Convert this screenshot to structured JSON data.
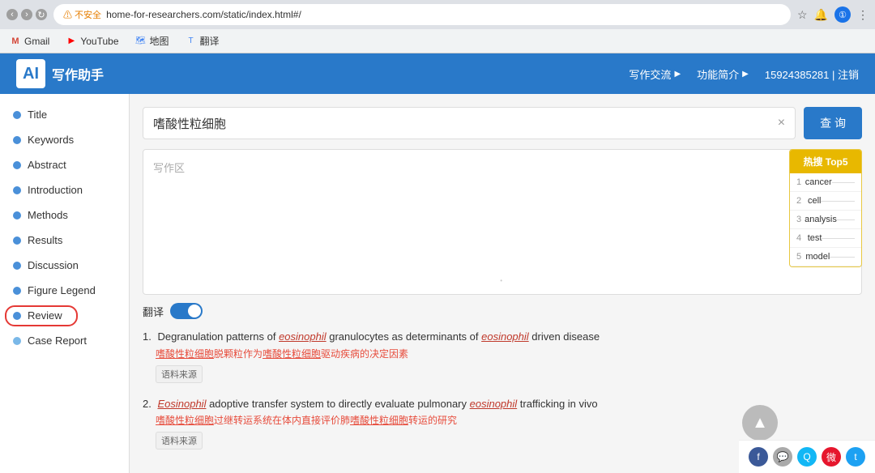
{
  "browser": {
    "address": "home-for-researchers.com/static/index.html#/",
    "warning_text": "不安全",
    "bookmarks": [
      {
        "name": "Gmail",
        "icon": "G",
        "type": "gmail"
      },
      {
        "name": "YouTube",
        "icon": "▶",
        "type": "youtube"
      },
      {
        "name": "地图",
        "icon": "📍",
        "type": "maps"
      },
      {
        "name": "翻译",
        "icon": "T",
        "type": "translate"
      }
    ]
  },
  "header": {
    "logo_letter": "AI",
    "logo_text": "写作助手",
    "nav": [
      {
        "label": "写作交流",
        "has_arrow": true
      },
      {
        "label": "功能简介",
        "has_arrow": true
      },
      {
        "label": "15924385281 | 注销"
      }
    ]
  },
  "sidebar": {
    "items": [
      {
        "label": "Title",
        "dot_color": "blue"
      },
      {
        "label": "Keywords",
        "dot_color": "blue"
      },
      {
        "label": "Abstract",
        "dot_color": "blue"
      },
      {
        "label": "Introduction",
        "dot_color": "blue"
      },
      {
        "label": "Methods",
        "dot_color": "blue"
      },
      {
        "label": "Results",
        "dot_color": "blue"
      },
      {
        "label": "Discussion",
        "dot_color": "blue"
      },
      {
        "label": "Figure Legend",
        "dot_color": "blue"
      },
      {
        "label": "Review",
        "dot_color": "blue",
        "highlighted": true
      },
      {
        "label": "Case Report",
        "dot_color": "light-blue"
      }
    ]
  },
  "search": {
    "value": "嗜酸性粒细胞",
    "placeholder": "写作区",
    "button_label": "查 询",
    "clear_icon": "×"
  },
  "writing_area": {
    "placeholder": "写作区"
  },
  "translation": {
    "label": "翻译",
    "enabled": true
  },
  "hot_panel": {
    "title": "热搜 Top5",
    "items": [
      {
        "rank": 1,
        "text": "cancer"
      },
      {
        "rank": 2,
        "text": "cell"
      },
      {
        "rank": 3,
        "text": "analysis"
      },
      {
        "rank": 4,
        "text": "test"
      },
      {
        "rank": 5,
        "text": "model"
      }
    ]
  },
  "results": [
    {
      "number": "1.",
      "text_parts": [
        {
          "type": "normal",
          "text": "Degranulation patterns of "
        },
        {
          "type": "italic-red",
          "text": "eosinophil"
        },
        {
          "type": "normal",
          "text": " granulocytes as determinants of "
        },
        {
          "type": "italic-red",
          "text": "eosinophil"
        },
        {
          "type": "normal",
          "text": " driven disease"
        }
      ],
      "translation_parts": [
        {
          "type": "underline-red",
          "text": "嗜酸性粒细胞"
        },
        {
          "type": "normal-red",
          "text": "脱颗粒作为"
        },
        {
          "type": "underline-red",
          "text": "嗜酸性粒细胞"
        },
        {
          "type": "normal-red",
          "text": "驱动疾病的决定因素"
        }
      ],
      "source_label": "语料来源"
    },
    {
      "number": "2.",
      "text_parts": [
        {
          "type": "italic-red",
          "text": "Eosinophil"
        },
        {
          "type": "normal",
          "text": " adoptive transfer system to directly evaluate pulmonary "
        },
        {
          "type": "italic-red",
          "text": "eosinophil"
        },
        {
          "type": "normal",
          "text": " trafficking in vivo"
        }
      ],
      "translation_parts": [
        {
          "type": "underline-red",
          "text": "嗜酸性粒细胞"
        },
        {
          "type": "normal-red",
          "text": "过继转运系统在体内直接评价肺"
        },
        {
          "type": "underline-red",
          "text": "嗜酸性粒细胞"
        },
        {
          "type": "normal-red",
          "text": "转运的研究"
        }
      ],
      "source_label": "语料来源"
    }
  ],
  "social_icons": [
    {
      "name": "facebook",
      "symbol": "f",
      "color": "#3b5998"
    },
    {
      "name": "chat",
      "symbol": "💬",
      "color": "#888"
    },
    {
      "name": "qq",
      "symbol": "Q",
      "color": "#12b7f5"
    },
    {
      "name": "weibo",
      "symbol": "微",
      "color": "#e6162d"
    },
    {
      "name": "twitter",
      "symbol": "t",
      "color": "#1da1f2"
    }
  ]
}
